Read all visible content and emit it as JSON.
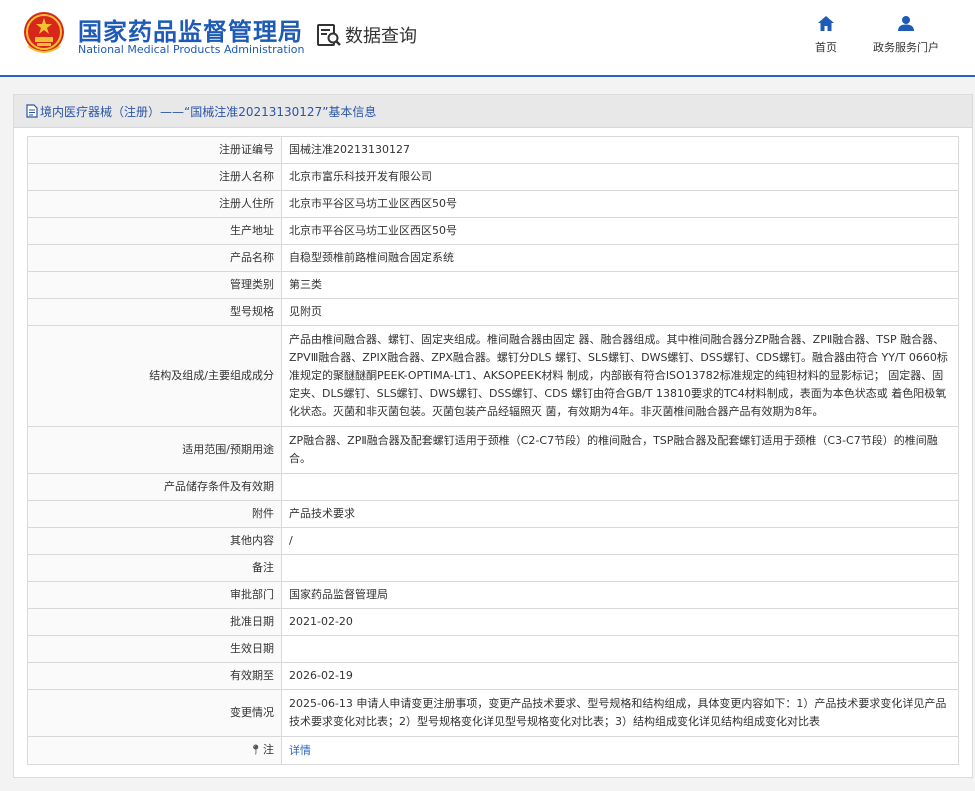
{
  "header": {
    "site_name_cn": "国家药品监督管理局",
    "site_name_en": "National Medical Products Administration",
    "query_label": "数据查询",
    "nav": [
      {
        "label": "首页",
        "icon": "home-icon"
      },
      {
        "label": "政务服务门户",
        "icon": "user-icon"
      }
    ]
  },
  "panel": {
    "title": "境内医疗器械（注册）——“国械注准20213130127”基本信息"
  },
  "rows": [
    {
      "key": "注册证编号",
      "value": "国械注准20213130127"
    },
    {
      "key": "注册人名称",
      "value": "北京市富乐科技开发有限公司"
    },
    {
      "key": "注册人住所",
      "value": "北京市平谷区马坊工业区西区50号"
    },
    {
      "key": "生产地址",
      "value": "北京市平谷区马坊工业区西区50号"
    },
    {
      "key": "产品名称",
      "value": "自稳型颈椎前路椎间融合固定系统"
    },
    {
      "key": "管理类别",
      "value": "第三类"
    },
    {
      "key": "型号规格",
      "value": "见附页"
    },
    {
      "key": "结构及组成/主要组成成分",
      "value": "产品由椎间融合器、螺钉、固定夹组成。椎间融合器由固定 器、融合器组成。其中椎间融合器分ZP融合器、ZPⅡ融合器、TSP 融合器、ZPVⅢ融合器、ZPIX融合器、ZPX融合器。螺钉分DLS 螺钉、SLS螺钉、DWS螺钉、DSS螺钉、CDS螺钉。融合器由符合 YY/T 0660标准规定的聚醚醚酮PEEK-OPTIMA-LT1、AKSOPEEK材料 制成，内部嵌有符合ISO13782标准规定的纯钽材料的显影标记； 固定器、固定夹、DLS螺钉、SLS螺钉、DWS螺钉、DSS螺钉、CDS 螺钉由符合GB/T 13810要求的TC4材料制成，表面为本色状态或 着色阳极氧化状态。灭菌和非灭菌包装。灭菌包装产品经辐照灭 菌，有效期为4年。非灭菌椎间融合器产品有效期为8年。"
    },
    {
      "key": "适用范围/预期用途",
      "value": "ZP融合器、ZPⅡ融合器及配套螺钉适用于颈椎（C2-C7节段）的椎间融合，TSP融合器及配套螺钉适用于颈椎（C3-C7节段）的椎间融合。"
    },
    {
      "key": "产品储存条件及有效期",
      "value": ""
    },
    {
      "key": "附件",
      "value": "产品技术要求"
    },
    {
      "key": "其他内容",
      "value": "/"
    },
    {
      "key": "备注",
      "value": ""
    },
    {
      "key": "审批部门",
      "value": "国家药品监督管理局"
    },
    {
      "key": "批准日期",
      "value": "2021-02-20"
    },
    {
      "key": "生效日期",
      "value": ""
    },
    {
      "key": "有效期至",
      "value": "2026-02-19"
    },
    {
      "key": "变更情况",
      "value": "2025-06-13 申请人申请变更注册事项，变更产品技术要求、型号规格和结构组成，具体变更内容如下：1）产品技术要求变化详见产品技术要求变化对比表；2）型号规格变化详见型号规格变化对比表；3）结构组成变化详见结构组成变化对比表"
    },
    {
      "key": "注",
      "value": "详情",
      "link": true,
      "key_icon": "pin-icon"
    }
  ]
}
